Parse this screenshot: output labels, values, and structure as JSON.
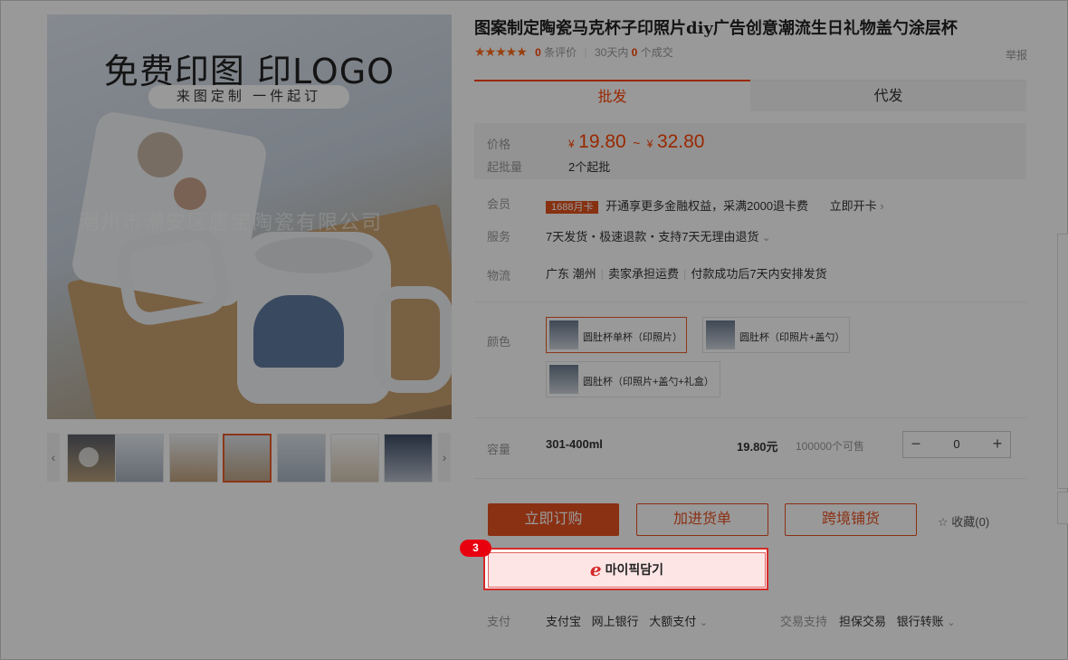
{
  "product": {
    "title": "图案制定陶瓷马克杯子印照片diy广告创意潮流生日礼物盖勺涂层杯",
    "promo_line1": "免费印图 印LOGO",
    "promo_line2": "来图定制 一件起订",
    "watermark": "潮州市潮安区唐宝陶瓷有限公司"
  },
  "rating": {
    "stars": "★★★★★",
    "review_count": "0",
    "review_label": "条评价",
    "period_label": "30天内",
    "deal_count": "0",
    "deal_label": "个成交",
    "report": "举报"
  },
  "tabs": [
    {
      "label": "批发",
      "active": true
    },
    {
      "label": "代发",
      "active": false
    }
  ],
  "price": {
    "label": "价格",
    "currency": "¥",
    "min": "19.80",
    "range_sep": "~",
    "max": "32.80",
    "moq_label": "起批量",
    "moq_value": "2个起批"
  },
  "member": {
    "label": "会员",
    "card": "1688月卡",
    "text": "开通享更多金融权益，采满2000退卡费",
    "link": "立即开卡"
  },
  "service": {
    "label": "服务",
    "text": "7天发货・极速退款・支持7天无理由退货"
  },
  "logistics": {
    "label": "物流",
    "origin": "广东 潮州",
    "shipping_fee": "卖家承担运费",
    "ship_time": "付款成功后7天内安排发货"
  },
  "color": {
    "label": "颜色",
    "options": [
      {
        "label": "圆肚杯单杯（印照片）",
        "selected": true
      },
      {
        "label": "圆肚杯（印照片+盖勺）",
        "selected": false
      },
      {
        "label": "圆肚杯（印照片+盖勺+礼盒）",
        "selected": false
      }
    ]
  },
  "capacity": {
    "label": "容量",
    "value": "301-400ml",
    "price": "19.80元",
    "stock": "100000个可售",
    "quantity": "0",
    "minus": "−",
    "plus": "+"
  },
  "actions": {
    "buy_now": "立即订购",
    "add_cart": "加进货单",
    "cross_border": "跨境铺货",
    "favorite": "收藏(0)"
  },
  "extension": {
    "badge": "3",
    "icon_glyph": "e",
    "label": "마이픽담기"
  },
  "payment": {
    "label": "支付",
    "methods": [
      "支付宝",
      "网上银行",
      "大额支付"
    ],
    "trade_label": "交易支持",
    "trade_items": [
      "担保交易",
      "银行转账"
    ]
  },
  "colors": {
    "accent": "#ff4400",
    "button": "#e65020",
    "highlight": "#d42a2a"
  }
}
